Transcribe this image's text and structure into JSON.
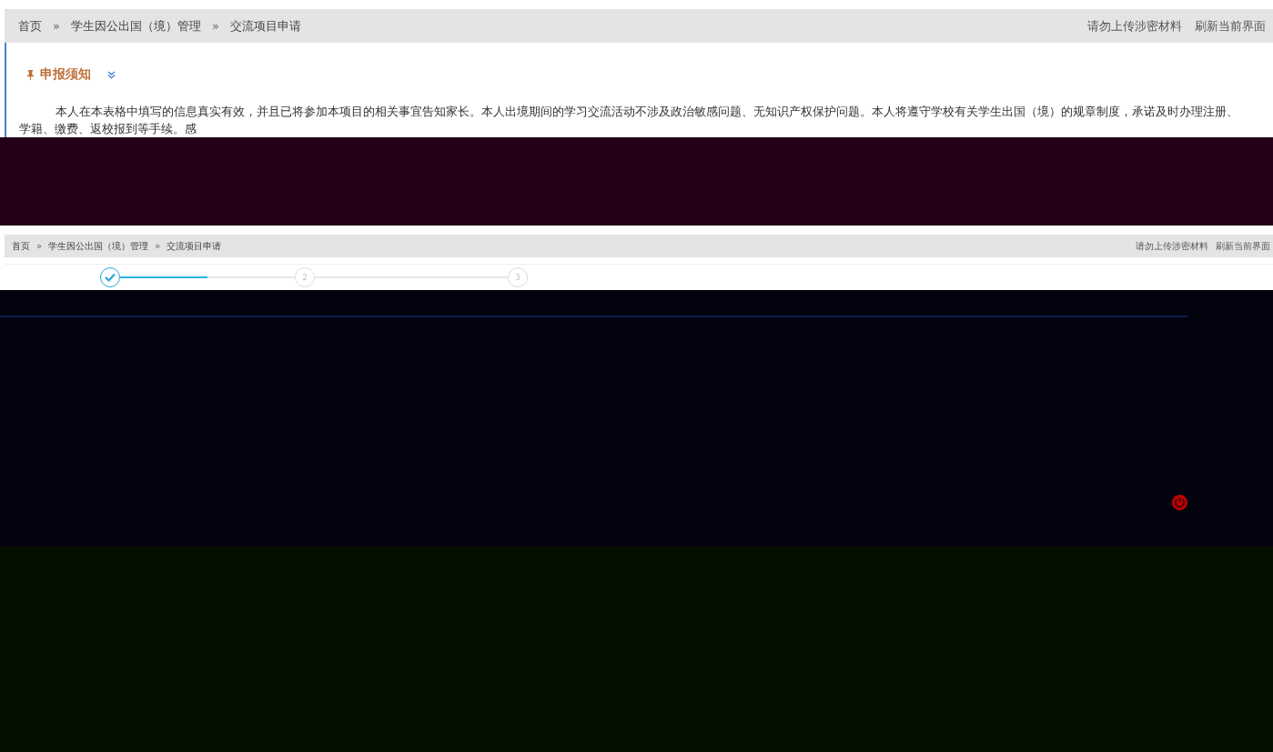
{
  "top": {
    "breadcrumb": {
      "items": [
        "首页",
        "学生因公出国（境）管理",
        "交流项目申请"
      ],
      "separators": [
        "»",
        "»"
      ]
    },
    "actions": [
      "请勿上传涉密材料",
      "刷新当前界面"
    ],
    "notice": {
      "title": "申报须知",
      "expanded": true,
      "lines": [
        "本人在本表格中填写的信息真实有效，并且已将参加本项目的相关事宜告知家长。本人出境期间的学习交流活动不涉及政治敏感问题、无知识产权保护问题。本人将遵守学校有关学生出国（境）的规章制度，承诺及时办理注册、",
        "学籍、缴费、返校报到等手续。感"
      ]
    }
  },
  "lower": {
    "breadcrumb": {
      "items": [
        "首页",
        "学生因公出国（境）管理",
        "交流项目申请"
      ],
      "separators": [
        "»",
        "»"
      ]
    },
    "actions": [
      "请勿上传涉密材料",
      "刷新当前界面"
    ],
    "steps": [
      {
        "done": true
      },
      {
        "done": false,
        "number": "2"
      },
      {
        "done": false,
        "number": "3"
      }
    ],
    "connectors": [
      {
        "level": 0.5
      }
    ]
  }
}
